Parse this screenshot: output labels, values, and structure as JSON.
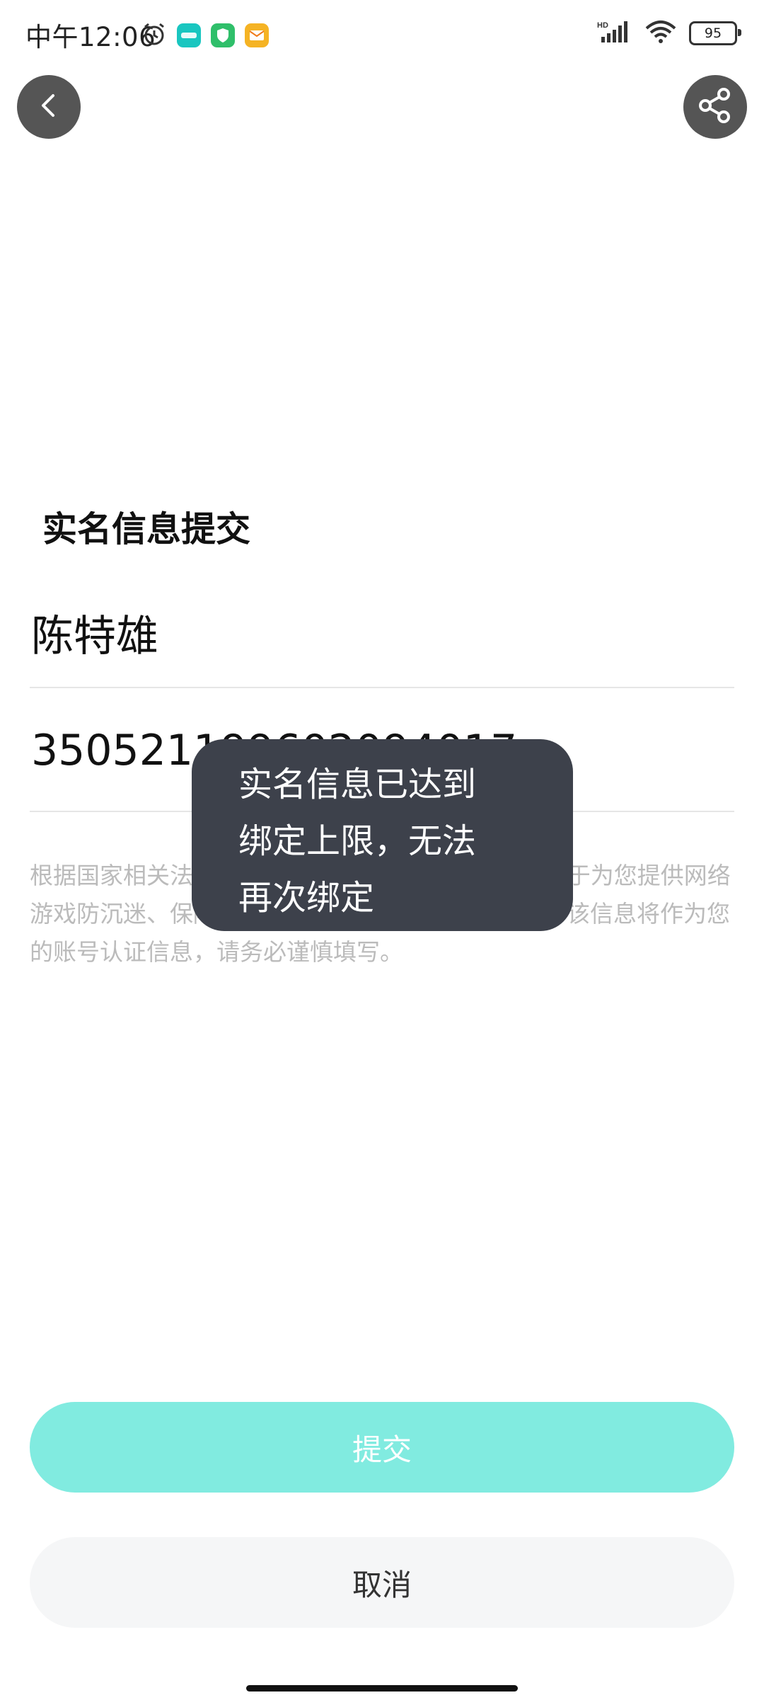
{
  "status_bar": {
    "time": "中午12:06",
    "battery": "95",
    "icons": [
      "alarm-icon",
      "taptap-app-icon",
      "shield-app-icon",
      "mail-app-icon",
      "hd-signal-icon",
      "wifi-icon",
      "battery-icon"
    ]
  },
  "nav": {
    "back_icon": "chevron-left-icon",
    "share_icon": "share-icon"
  },
  "form": {
    "title": "实名信息提交",
    "name_value": "陈特雄",
    "id_value": "350521199602094017",
    "notice": "根据国家相关法律法规要求，以上信息 TapTap 将用于为您提供网络游戏防沉迷、保障未成年人权益、信息发布等服务。该信息将作为您的账号认证信息，请务必谨慎填写。"
  },
  "toast": {
    "lines": [
      "实名信息已达到",
      "绑定上限，无法",
      "再次绑定"
    ]
  },
  "buttons": {
    "submit": "提交",
    "cancel": "取消"
  },
  "colors": {
    "accent": "#81ebe0",
    "toast_bg": "#3d414b",
    "notice_text": "#bbbbbb"
  }
}
